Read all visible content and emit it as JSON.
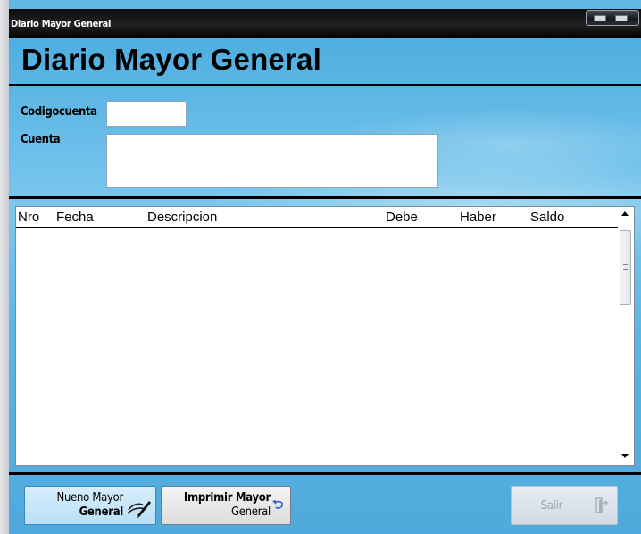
{
  "window": {
    "title": "Diario Mayor General"
  },
  "header": {
    "title": "Diario Mayor General"
  },
  "form": {
    "codigo_label": "Codigocuenta",
    "codigo_value": "",
    "cuenta_label": "Cuenta",
    "cuenta_value": ""
  },
  "grid": {
    "columns": [
      "Nro",
      "Fecha",
      "Descripcion",
      "Debe",
      "Haber",
      "Saldo"
    ],
    "rows": []
  },
  "buttons": {
    "nuevo": {
      "line1": "Nueno Mayor",
      "line2": "General",
      "icon": "pen-write-icon"
    },
    "imprimir": {
      "line1": "Imprimir Mayor",
      "line2": "General",
      "icon": "undo-arrow-icon"
    },
    "salir": {
      "label": "Salir",
      "icon": "exit-door-icon",
      "enabled": false
    }
  }
}
